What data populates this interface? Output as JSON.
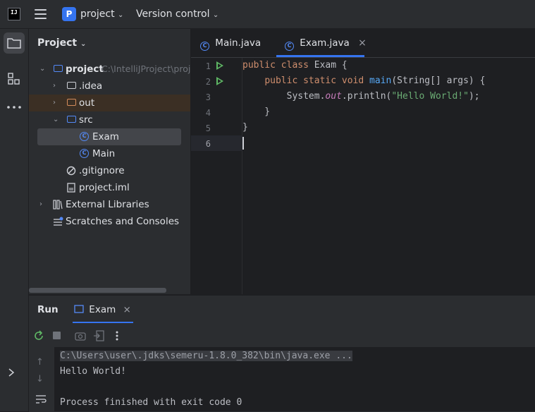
{
  "titlebar": {
    "logo_text": "IJ",
    "project_badge": "P",
    "project_name": "project",
    "vcs_label": "Version control"
  },
  "project_panel": {
    "title": "Project",
    "tree": [
      {
        "label": "project",
        "detail": "C:\\IntelliJProject\\project"
      },
      {
        "label": ".idea"
      },
      {
        "label": "out"
      },
      {
        "label": "src"
      },
      {
        "label": "Exam"
      },
      {
        "label": "Main"
      },
      {
        "label": ".gitignore"
      },
      {
        "label": "project.iml"
      },
      {
        "label": "External Libraries"
      },
      {
        "label": "Scratches and Consoles"
      }
    ]
  },
  "editor": {
    "tabs": [
      {
        "label": "Main.java",
        "active": false
      },
      {
        "label": "Exam.java",
        "active": true
      }
    ],
    "line_numbers": [
      "1",
      "2",
      "3",
      "4",
      "5",
      "6"
    ],
    "code": {
      "l1_kw": "public class ",
      "l1_rest": "Exam {",
      "l2_indent": "    ",
      "l2_kw": "public static void ",
      "l2_fn": "main",
      "l2_rest": "(String[] args) {",
      "l3_indent": "        ",
      "l3_a": "System.",
      "l3_out": "out",
      "l3_b": ".println(",
      "l3_str": "\"Hello World!\"",
      "l3_c": ");",
      "l4": "    }",
      "l5": "}"
    }
  },
  "run_panel": {
    "title": "Run",
    "tab_label": "Exam",
    "console": {
      "command": "C:\\Users\\user\\.jdks\\semeru-1.8.0_382\\bin\\java.exe ...",
      "output": "Hello World!",
      "exit": "Process finished with exit code 0"
    }
  },
  "colors": {
    "accent": "#3574f0",
    "run_green": "#5fb865",
    "keyword": "#cf8e6d",
    "function": "#56a8f5",
    "string": "#6aab73"
  }
}
